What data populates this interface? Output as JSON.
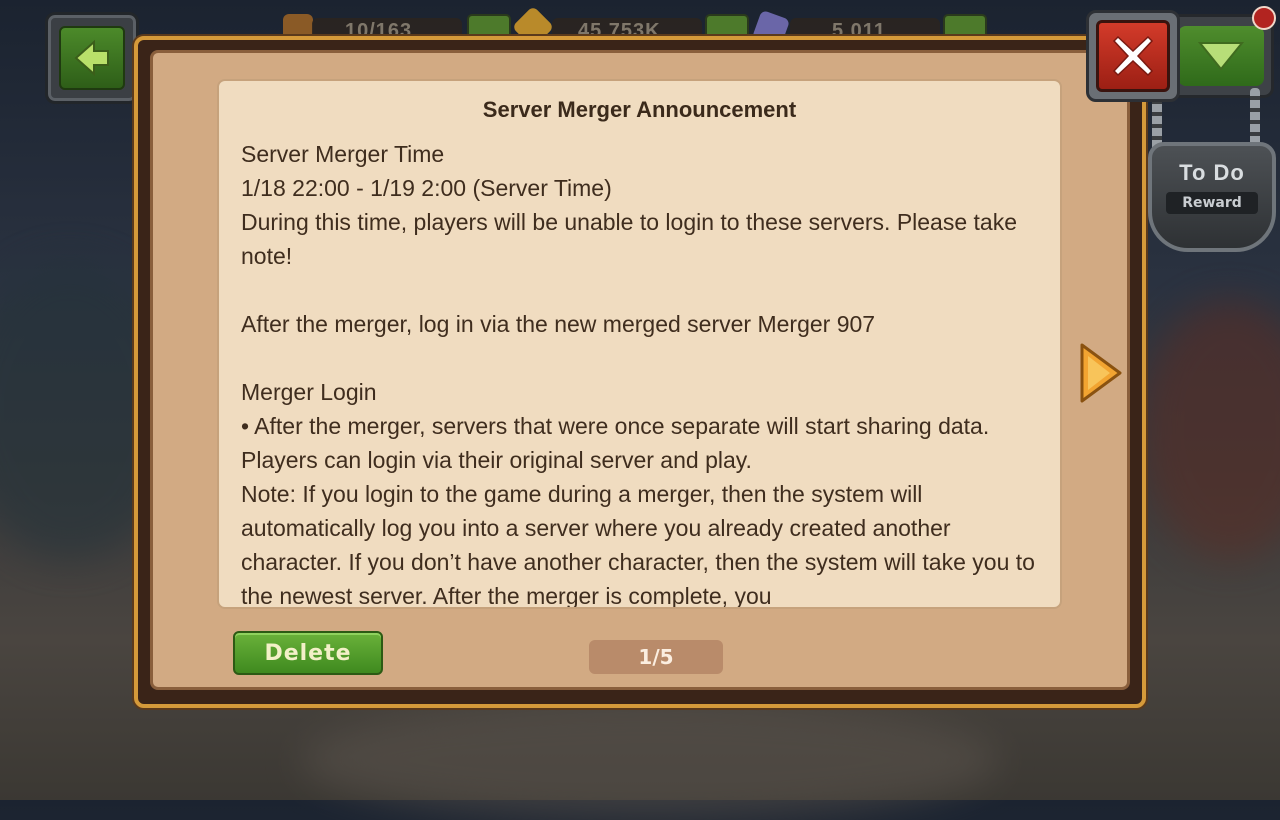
{
  "hud": {
    "resource_1": "10/163",
    "resource_2": "45,753K",
    "resource_3": "5,011"
  },
  "todo": {
    "title": "To Do",
    "reward": "Reward"
  },
  "announcement": {
    "title": "Server Merger Announcement",
    "paragraphs": [
      "Server Merger Time",
      "1/18 22:00 - 1/19 2:00 (Server Time)",
      "During this time, players will be unable to login to these servers. Please take note!",
      "",
      "After the merger, log in via the new merged server Merger 907",
      "",
      "Merger Login",
      "• After the merger, servers that were once separate will start sharing data. Players can login via their original server and play.",
      "Note: If you login to the game during a merger, then the system will automatically log you into a server where you already created another character. If you don’t have another character, then the system will take you to the newest server. After the merger is complete, you"
    ]
  },
  "footer": {
    "delete_label": "Delete",
    "page_indicator": "1/5"
  },
  "colors": {
    "dialog_border": "#d59a3a",
    "paper": "#f0dcc0",
    "delete_green": "#4f9a28",
    "close_red": "#c9322a"
  }
}
